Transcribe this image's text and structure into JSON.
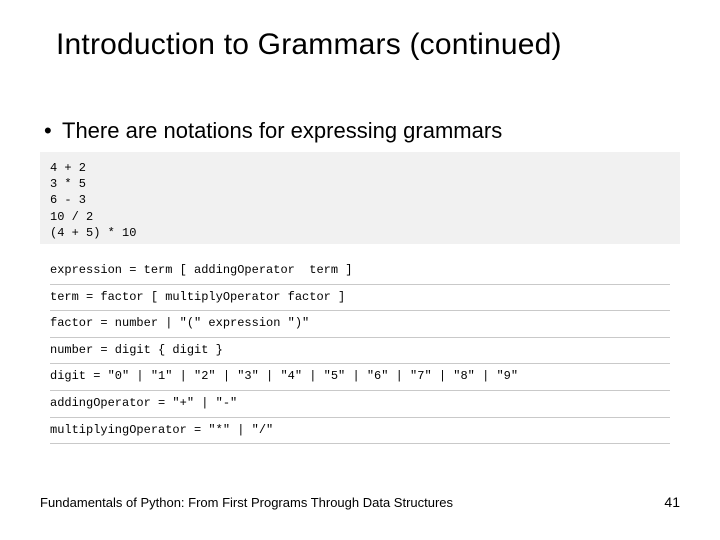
{
  "title": "Introduction to Grammars (continued)",
  "bullet": {
    "marker": "•",
    "text": "There are notations for expressing grammars"
  },
  "examples": [
    "4 + 2",
    "3 * 5",
    "6 - 3",
    "10 / 2",
    "(4 + 5) * 10"
  ],
  "grammar": [
    "expression = term [ addingOperator  term ]",
    "term = factor [ multiplyOperator factor ]",
    "factor = number | \"(\" expression \")\"",
    "number = digit { digit }",
    "digit = \"0\" | \"1\" | \"2\" | \"3\" | \"4\" | \"5\" | \"6\" | \"7\" | \"8\" | \"9\"",
    "addingOperator = \"+\" | \"-\"",
    "multiplyingOperator = \"*\" | \"/\""
  ],
  "footer": {
    "left": "Fundamentals of Python: From First Programs Through Data Structures",
    "page": "41"
  }
}
